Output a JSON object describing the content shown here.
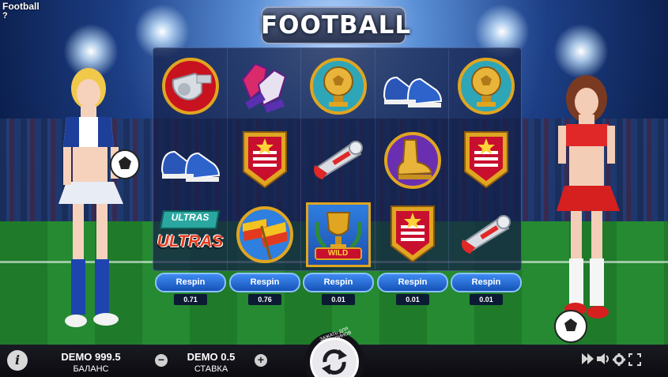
{
  "game_title": "Football",
  "help_label": "?",
  "logo_text": "FOOTBALL",
  "reels": [
    {
      "symbols": [
        "whistle",
        "goalkeeper-gloves",
        "shoes"
      ],
      "respin_label": "Respin",
      "respin_price": "0.71"
    },
    {
      "symbols": [
        "shoes",
        "pennant",
        "flags"
      ],
      "respin_label": "Respin",
      "respin_price": "0.76"
    },
    {
      "symbols": [
        "golden-ball-trophy",
        "horn",
        "wild"
      ],
      "respin_label": "Respin",
      "respin_price": "0.01"
    },
    {
      "symbols": [
        "shoes",
        "golden-boot",
        "pennant"
      ],
      "respin_label": "Respin",
      "respin_price": "0.01"
    },
    {
      "symbols": [
        "golden-ball-trophy",
        "pennant",
        "horn"
      ],
      "respin_label": "Respin",
      "respin_price": "0.01"
    }
  ],
  "ultras_text": {
    "top": "ULTRAS",
    "bottom": "ULTRAS"
  },
  "wild_label": "WILD",
  "balance": {
    "value": "DEMO 999.5",
    "label": "БАЛАНС"
  },
  "bet": {
    "value": "DEMO 0.5",
    "label": "СТАВКА"
  },
  "minus_label": "−",
  "plus_label": "+",
  "autospin_hint": "ЗАЖАТЬ ДЛЯ АВТОСПИНОВ",
  "info_label": "i",
  "icons": [
    "info-icon",
    "minus-icon",
    "plus-icon",
    "spin-icon",
    "fast-forward-icon",
    "sound-icon",
    "gear-icon",
    "fullscreen-icon"
  ],
  "colors": {
    "respin_button": "#2f76e0",
    "bottom_bar": "#111118",
    "board": "#1a2a5c",
    "pennant_red": "#c8102e",
    "gold": "#e0a521"
  }
}
